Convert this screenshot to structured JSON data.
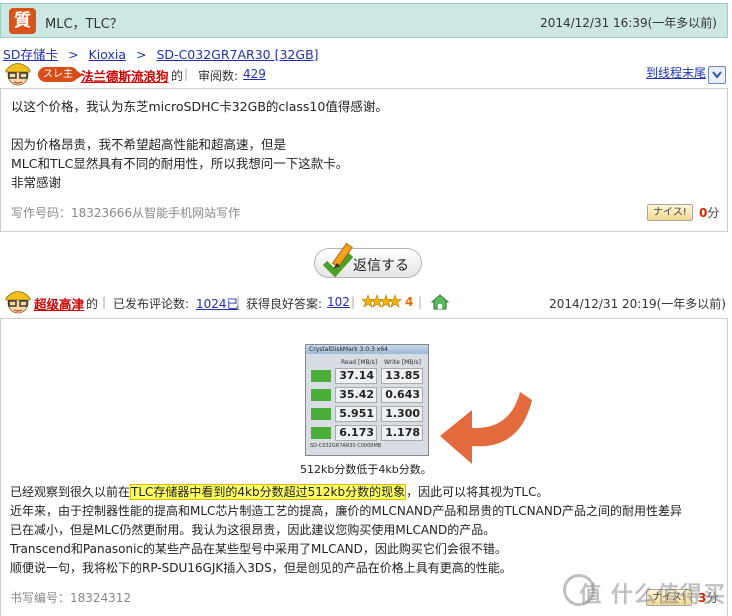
{
  "question": {
    "badge": "質",
    "title": "MLC，TLC？",
    "time": "2014/12/31 16:39(一年多以前)"
  },
  "breadcrumb": [
    "SD存储卡",
    "Kioxia",
    "SD-C032GR7AR30 [32GB]"
  ],
  "asker": {
    "role_badge": "スレ主",
    "name": "法兰德斯流浪狗",
    "suffix": "的",
    "review_label": "审阅数:",
    "review_count": "429",
    "tail_link": "到线程末尾"
  },
  "question_body": {
    "lines": [
      "以这个价格，我认为东芝microSDHC卡32GB的class10值得感谢。",
      "",
      "因为价格昂贵，我不希望超高性能和超高速，但是",
      "MLC和TLC显然具有不同的耐用性，所以我想问一下这款卡。",
      "非常感谢"
    ],
    "post_meta": "写作号码：18323666从智能手机网站写作",
    "nice_label": "ナイス!",
    "score": "0",
    "score_unit": "分"
  },
  "reply_button": "返信する",
  "answerer": {
    "name": "超级高津",
    "suffix": "的",
    "posted_label": "已发布评论数:",
    "posted_count": "1024",
    "posted_suffix": "已",
    "good_label": "获得良好答案:",
    "good_count": "102",
    "stars": "4",
    "time": "2014/12/31 20:19(一年多以前)"
  },
  "screenshot": {
    "title": "CrystalDiskMark 3.0.3 x64",
    "col_read": "Read [MB/s]",
    "col_write": "Write [MB/s]",
    "rows": [
      {
        "read": "37.14",
        "write": "13.85"
      },
      {
        "read": "35.42",
        "write": "0.643"
      },
      {
        "read": "5.951",
        "write": "1.300"
      },
      {
        "read": "6.173",
        "write": "1.178"
      }
    ],
    "footer": "SD-C032GR7AR30 C0000MB",
    "caption": "512kb分数低于4kb分数。"
  },
  "answer_body": {
    "line1_pre": "已经观察到很久以前在",
    "line1_hl": "TLC存储器中看到的4kb分数超过512kb分数的现象",
    "line1_post": "，因此可以将其视为TLC。",
    "line2": "近年来，由于控制器性能的提高和MLC芯片制造工艺的提高，廉价的MLCNAND产品和昂贵的TLCNAND产品之间的耐用性差异",
    "line3": "已在减小，但是MLC仍然更耐用。我认为这很昂贵，因此建议您购买使用MLCAND的产品。",
    "line4": "Transcend和Panasonic的某些产品在某些型号中采用了MLCAND，因此购买它们会很不错。",
    "line5": "顺便说一句，我将松下的RP-SDU16GJK插入3DS，但是创见的产品在价格上具有更高的性能。",
    "post_meta": "书写编号：18324312",
    "score": "3"
  },
  "watermark": "值 什么值得买"
}
